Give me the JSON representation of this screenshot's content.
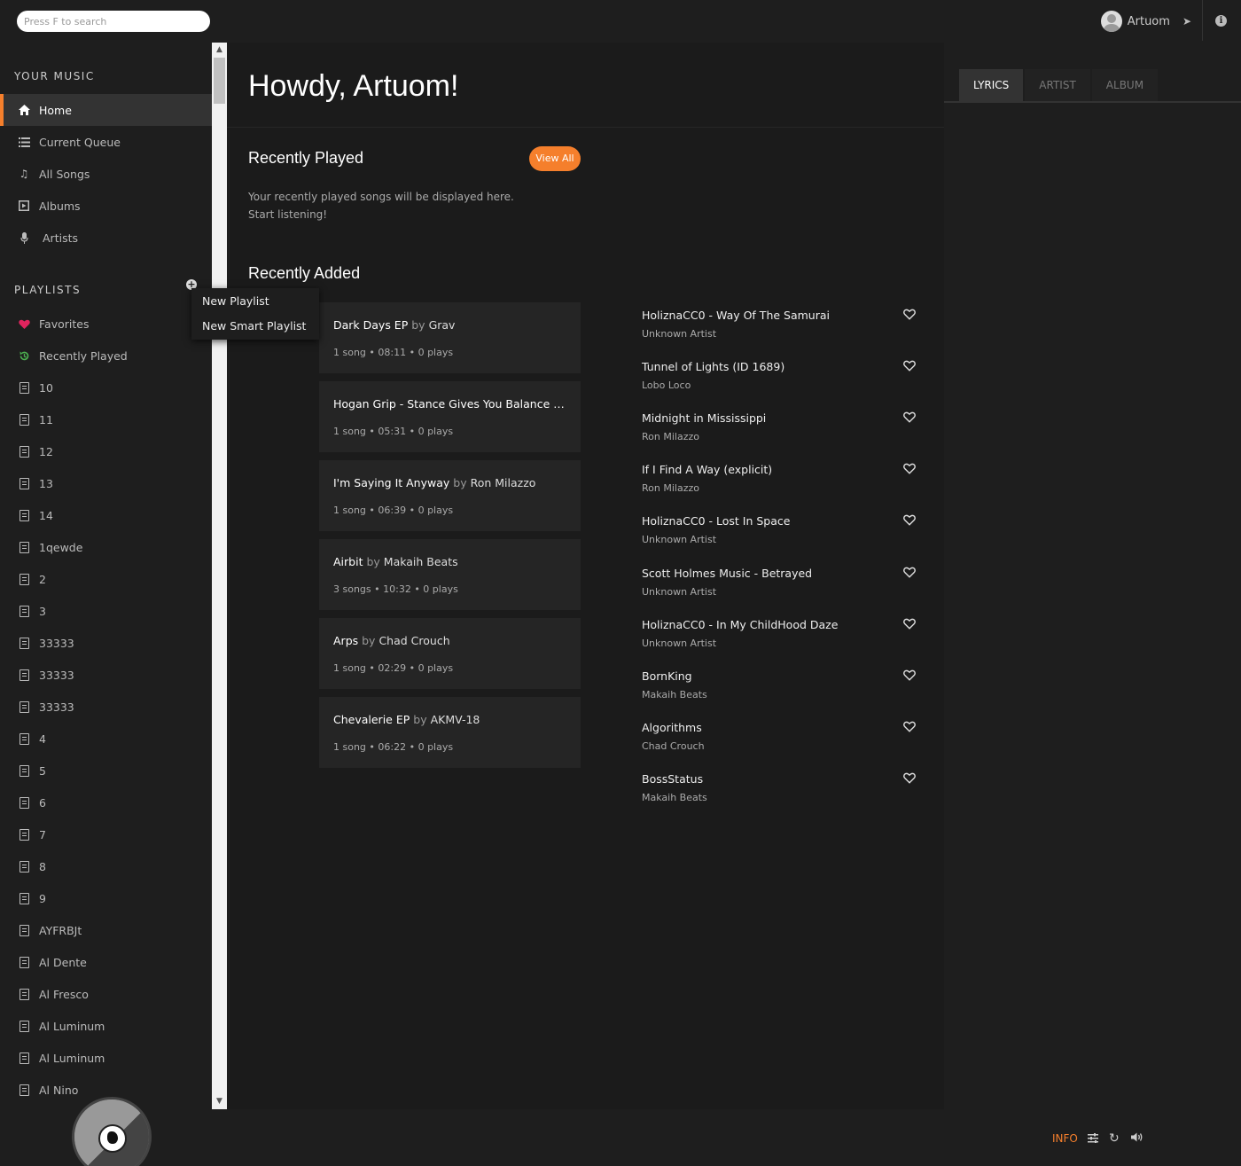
{
  "search": {
    "placeholder": "Press F to search"
  },
  "user": {
    "name": "Artuom"
  },
  "sidebar": {
    "your_music_title": "YOUR MUSIC",
    "nav": [
      {
        "label": "Home",
        "icon": "home-icon",
        "active": true
      },
      {
        "label": "Current Queue",
        "icon": "list-icon"
      },
      {
        "label": "All Songs",
        "icon": "music-note-icon"
      },
      {
        "label": "Albums",
        "icon": "album-icon"
      },
      {
        "label": "Artists",
        "icon": "microphone-icon"
      }
    ],
    "playlists_title": "PLAYLISTS",
    "playlists": [
      {
        "label": "Favorites",
        "icon": "heart-icon"
      },
      {
        "label": "Recently Played",
        "icon": "history-icon"
      },
      {
        "label": "10"
      },
      {
        "label": "11"
      },
      {
        "label": "12"
      },
      {
        "label": "13"
      },
      {
        "label": "14"
      },
      {
        "label": "1qewde"
      },
      {
        "label": "2"
      },
      {
        "label": "3"
      },
      {
        "label": "33333"
      },
      {
        "label": "33333"
      },
      {
        "label": "33333"
      },
      {
        "label": "4"
      },
      {
        "label": "5"
      },
      {
        "label": "6"
      },
      {
        "label": "7"
      },
      {
        "label": "8"
      },
      {
        "label": "9"
      },
      {
        "label": "AYFRBJt"
      },
      {
        "label": "Al Dente"
      },
      {
        "label": "Al Fresco"
      },
      {
        "label": "Al Luminum"
      },
      {
        "label": "Al Luminum"
      },
      {
        "label": "Al Nino"
      }
    ]
  },
  "context_menu": {
    "items": [
      "New Playlist",
      "New Smart Playlist"
    ]
  },
  "main": {
    "greeting": "Howdy, Artuom!",
    "recently_played": {
      "title": "Recently Played",
      "view_all": "View All",
      "empty_line1": "Your recently played songs will be displayed here.",
      "empty_line2": "Start listening!"
    },
    "recently_added": {
      "title": "Recently Added",
      "albums": [
        {
          "name": "Dark Days EP",
          "by": "by",
          "artist": "Grav",
          "meta": "1 song • 08:11 • 0 plays"
        },
        {
          "name": "Hogan Grip - Stance Gives You Balance",
          "by": "by",
          "artist": "...",
          "meta": "1 song • 05:31 • 0 plays"
        },
        {
          "name": "I'm Saying It Anyway",
          "by": "by",
          "artist": "Ron Milazzo",
          "meta": "1 song • 06:39 • 0 plays"
        },
        {
          "name": "Airbit",
          "by": "by",
          "artist": "Makaih Beats",
          "meta": "3 songs • 10:32 • 0 plays"
        },
        {
          "name": "Arps",
          "by": "by",
          "artist": "Chad Crouch",
          "meta": "1 song • 02:29 • 0 plays"
        },
        {
          "name": "Chevalerie EP",
          "by": "by",
          "artist": "AKMV-18",
          "meta": "1 song • 06:22 • 0 plays"
        }
      ],
      "songs": [
        {
          "title": "HoliznaCC0 - Way Of The Samurai",
          "artist": "Unknown Artist"
        },
        {
          "title": "Tunnel of Lights (ID 1689)",
          "artist": "Lobo Loco"
        },
        {
          "title": "Midnight in Mississippi",
          "artist": "Ron Milazzo"
        },
        {
          "title": "If I Find A Way (explicit)",
          "artist": "Ron Milazzo"
        },
        {
          "title": "HoliznaCC0 - Lost In Space",
          "artist": "Unknown Artist"
        },
        {
          "title": "Scott Holmes Music - Betrayed",
          "artist": "Unknown Artist"
        },
        {
          "title": "HoliznaCC0 - In My ChildHood Daze",
          "artist": "Unknown Artist"
        },
        {
          "title": "BornKing",
          "artist": "Makaih Beats"
        },
        {
          "title": "Algorithms",
          "artist": "Chad Crouch"
        },
        {
          "title": "BossStatus",
          "artist": "Makaih Beats"
        }
      ]
    }
  },
  "right_panel": {
    "tabs": [
      "LYRICS",
      "ARTIST",
      "ALBUM"
    ],
    "active_tab": "LYRICS"
  },
  "footer": {
    "info_label": "INFO"
  },
  "colors": {
    "accent": "#f57f2c",
    "background": "#1e1e1e",
    "main_background": "#1b1b1b",
    "card": "#252525"
  }
}
